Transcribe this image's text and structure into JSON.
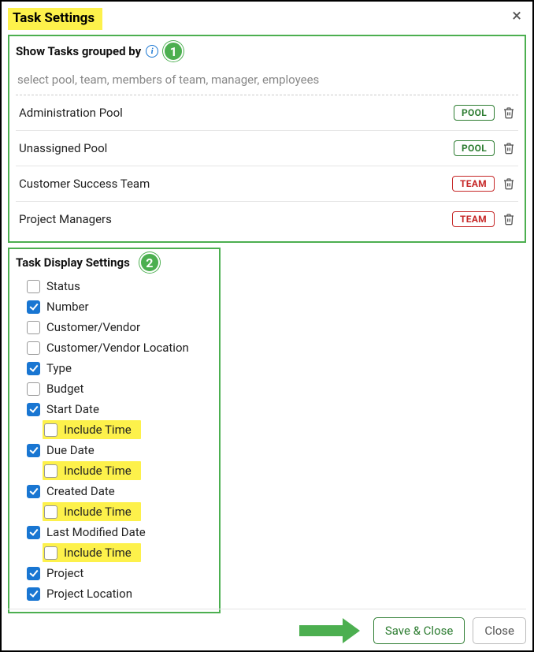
{
  "title": "Task Settings",
  "close_icon": "×",
  "section1": {
    "label": "Show Tasks grouped by",
    "badge": "1",
    "placeholder": "select pool, team, members of team, manager, employees",
    "items": [
      {
        "name": "Administration Pool",
        "tag": "POOL",
        "tag_kind": "pool"
      },
      {
        "name": "Unassigned Pool",
        "tag": "POOL",
        "tag_kind": "pool"
      },
      {
        "name": "Customer Success Team",
        "tag": "TEAM",
        "tag_kind": "team"
      },
      {
        "name": "Project Managers",
        "tag": "TEAM",
        "tag_kind": "team"
      }
    ]
  },
  "section2": {
    "title": "Task Display Settings",
    "badge": "2",
    "options": [
      {
        "label": "Status",
        "checked": false
      },
      {
        "label": "Number",
        "checked": true
      },
      {
        "label": "Customer/Vendor",
        "checked": false
      },
      {
        "label": "Customer/Vendor Location",
        "checked": false
      },
      {
        "label": "Type",
        "checked": true
      },
      {
        "label": "Budget",
        "checked": false
      },
      {
        "label": "Start Date",
        "checked": true
      },
      {
        "label": "Include Time",
        "checked": false,
        "indent": true,
        "highlight": true
      },
      {
        "label": "Due Date",
        "checked": true
      },
      {
        "label": "Include Time",
        "checked": false,
        "indent": true,
        "highlight": true
      },
      {
        "label": "Created Date",
        "checked": true
      },
      {
        "label": "Include Time",
        "checked": false,
        "indent": true,
        "highlight": true
      },
      {
        "label": "Last Modified Date",
        "checked": true
      },
      {
        "label": "Include Time",
        "checked": false,
        "indent": true,
        "highlight": true
      },
      {
        "label": "Project",
        "checked": true
      },
      {
        "label": "Project Location",
        "checked": true
      }
    ]
  },
  "footer": {
    "save": "Save & Close",
    "close": "Close"
  }
}
